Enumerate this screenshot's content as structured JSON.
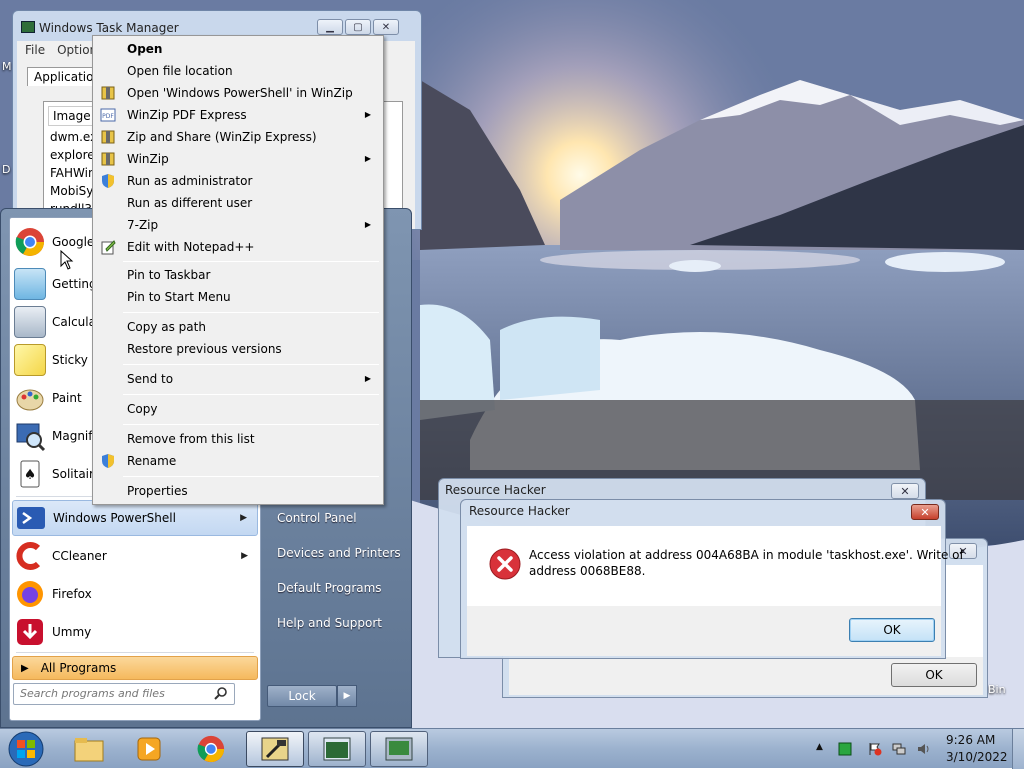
{
  "desktop": {
    "recycle_bin_fragment": "Bin",
    "left_edge_labels": [
      "M",
      "D"
    ]
  },
  "task_manager": {
    "title": "Windows Task Manager",
    "menu": [
      "File",
      "Options"
    ],
    "tab": "Applications",
    "column_header": "Image Na",
    "processes": [
      "dwm.exe",
      "explorer.",
      "FAHWind",
      "MobiSyst",
      "rundll32."
    ]
  },
  "context_menu": {
    "items": [
      {
        "label": "Open",
        "bold": true
      },
      {
        "label": "Open file location"
      },
      {
        "label": "Open 'Windows PowerShell' in WinZip",
        "icon": "winzip-icon"
      },
      {
        "label": "WinZip PDF Express",
        "icon": "winzip-pdf-icon",
        "submenu": true
      },
      {
        "label": "Zip and Share (WinZip Express)",
        "icon": "winzip-icon"
      },
      {
        "label": "WinZip",
        "icon": "winzip-icon",
        "submenu": true
      },
      {
        "label": "Run as administrator",
        "icon": "uac-shield-icon"
      },
      {
        "label": "Run as different user"
      },
      {
        "label": "7-Zip",
        "submenu": true
      },
      {
        "label": "Edit with Notepad++",
        "icon": "notepadpp-icon"
      },
      {
        "label": "Pin to Taskbar"
      },
      {
        "label": "Pin to Start Menu"
      },
      {
        "label": "Copy as path"
      },
      {
        "label": "Restore previous versions"
      },
      {
        "label": "Send to",
        "submenu": true
      },
      {
        "label": "Copy"
      },
      {
        "label": "Remove from this list"
      },
      {
        "label": "Rename",
        "icon": "uac-shield-icon"
      },
      {
        "label": "Properties"
      }
    ]
  },
  "start_menu": {
    "programs": [
      {
        "label": "Google",
        "icon": "chrome-icon"
      },
      {
        "label": "Getting",
        "icon": "getting-started-icon"
      },
      {
        "label": "Calculat",
        "icon": "calculator-icon"
      },
      {
        "label": "Sticky N",
        "icon": "sticky-notes-icon"
      },
      {
        "label": "Paint",
        "icon": "paint-icon"
      },
      {
        "label": "Magnifi",
        "icon": "magnifier-icon"
      },
      {
        "label": "Solitaire",
        "icon": "solitaire-icon"
      },
      {
        "label": "Windows PowerShell",
        "icon": "powershell-icon",
        "submenu": true,
        "highlighted": true
      },
      {
        "label": "CCleaner",
        "icon": "ccleaner-icon",
        "submenu": true
      },
      {
        "label": "Firefox",
        "icon": "firefox-icon"
      },
      {
        "label": "Ummy",
        "icon": "ummy-icon"
      }
    ],
    "all_programs": "All Programs",
    "search_placeholder": "Search programs and files",
    "right_items": [
      "Control Panel",
      "Devices and Printers",
      "Default Programs",
      "Help and Support"
    ],
    "lock_label": "Lock"
  },
  "dialogs": {
    "back_window": {
      "title": "Resource Hacker",
      "close": "✕"
    },
    "third_window": {
      "close": "✕",
      "ok": "OK"
    },
    "front_window": {
      "title": "Resource Hacker",
      "close": "✕",
      "message_line1": "Access violation at address 004A68BA in module 'taskhost.exe'. Write of",
      "message_line2": "address 0068BE88.",
      "ok": "OK"
    }
  },
  "taskbar": {
    "pinned": [
      "explorer-icon",
      "media-player-icon",
      "chrome-icon",
      "resource-hacker-icon",
      "task-manager-icon",
      "terminal-icon"
    ],
    "clock_time": "9:26 AM",
    "clock_date": "3/10/2022"
  },
  "colors": {
    "selection_highlight": "#c3d8f2",
    "all_programs": "#f5b95d",
    "error_red": "#d8323a"
  }
}
